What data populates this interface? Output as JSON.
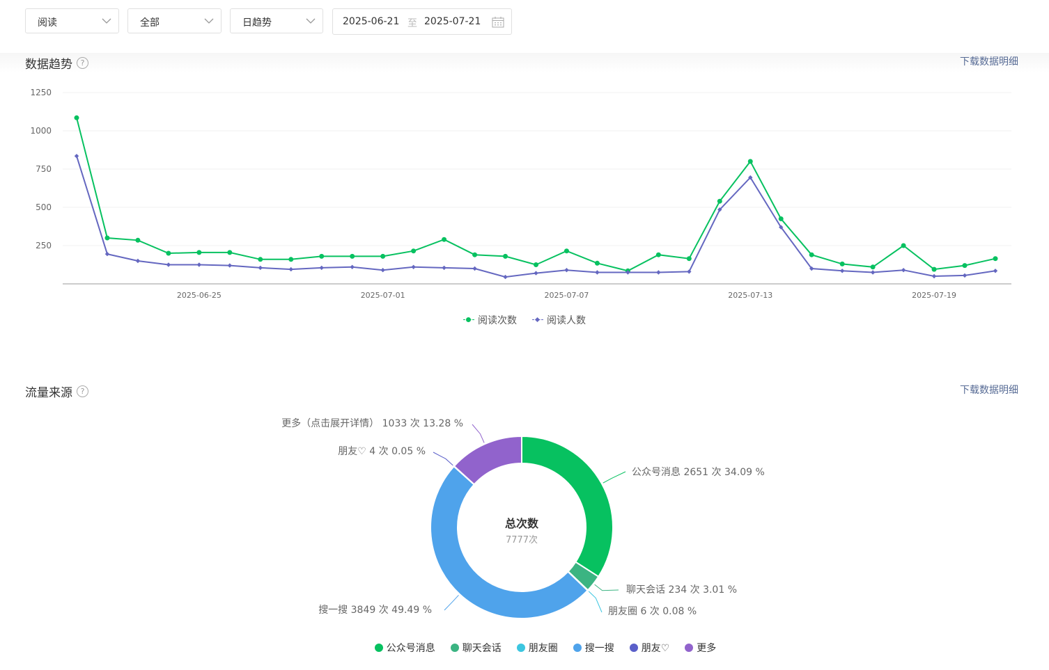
{
  "filters": {
    "metric": "阅读",
    "scope": "全部",
    "granularity": "日趋势",
    "date_start": "2025-06-21",
    "date_sep": "至",
    "date_end": "2025-07-21"
  },
  "trend_section": {
    "title": "数据趋势",
    "help": "?",
    "download": "下载数据明细"
  },
  "source_section": {
    "title": "流量来源",
    "help": "?",
    "download": "下载数据明细"
  },
  "colors": {
    "green": "#07c160",
    "indigo": "#6467c0",
    "link": "#576b95"
  },
  "chart_data": [
    {
      "type": "line",
      "x": [
        "2025-06-21",
        "2025-06-22",
        "2025-06-23",
        "2025-06-24",
        "2025-06-25",
        "2025-06-26",
        "2025-06-27",
        "2025-06-28",
        "2025-06-29",
        "2025-06-30",
        "2025-07-01",
        "2025-07-02",
        "2025-07-03",
        "2025-07-04",
        "2025-07-05",
        "2025-07-06",
        "2025-07-07",
        "2025-07-08",
        "2025-07-09",
        "2025-07-10",
        "2025-07-11",
        "2025-07-12",
        "2025-07-13",
        "2025-07-14",
        "2025-07-15",
        "2025-07-16",
        "2025-07-17",
        "2025-07-18",
        "2025-07-19",
        "2025-07-20",
        "2025-07-21"
      ],
      "xticks": [
        "2025-06-25",
        "2025-07-01",
        "2025-07-07",
        "2025-07-13",
        "2025-07-19"
      ],
      "yticks": [
        250,
        500,
        750,
        1000,
        1250
      ],
      "ylim": [
        0,
        1250
      ],
      "series": [
        {
          "name": "阅读次数",
          "color": "#07c160",
          "marker": "circle",
          "values": [
            1085,
            300,
            285,
            200,
            205,
            205,
            160,
            160,
            180,
            180,
            180,
            215,
            290,
            190,
            180,
            125,
            215,
            135,
            85,
            190,
            165,
            540,
            800,
            425,
            190,
            130,
            110,
            250,
            95,
            120,
            165
          ]
        },
        {
          "name": "阅读人数",
          "color": "#6467c0",
          "marker": "diamond",
          "values": [
            835,
            195,
            150,
            125,
            125,
            120,
            105,
            95,
            105,
            110,
            90,
            110,
            105,
            100,
            45,
            70,
            90,
            75,
            75,
            75,
            80,
            485,
            695,
            370,
            100,
            85,
            75,
            90,
            50,
            55,
            85
          ]
        }
      ]
    },
    {
      "type": "pie",
      "center_title": "总次数",
      "center_value": "7777次",
      "slices": [
        {
          "name": "公众号消息",
          "count": 2651,
          "unit": "次",
          "percent": "34.09 %",
          "color": "#07c160",
          "label": "公众号消息 2651 次 34.09 %"
        },
        {
          "name": "聊天会话",
          "count": 234,
          "unit": "次",
          "percent": "3.01 %",
          "color": "#3bb482",
          "label": "聊天会话 234 次 3.01 %"
        },
        {
          "name": "朋友圈",
          "count": 6,
          "unit": "次",
          "percent": "0.08 %",
          "color": "#3cc6e0",
          "label": "朋友圈 6 次 0.08 %"
        },
        {
          "name": "搜一搜",
          "count": 3849,
          "unit": "次",
          "percent": "49.49 %",
          "color": "#4fa3eb",
          "label": "搜一搜 3849 次 49.49 %"
        },
        {
          "name": "朋友♡",
          "count": 4,
          "unit": "次",
          "percent": "0.05 %",
          "color": "#5a5fc9",
          "label": "朋友♡ 4 次 0.05 %"
        },
        {
          "name": "更多",
          "count": 1033,
          "unit": "次",
          "percent": "13.28 %",
          "color": "#9163cc",
          "label": "更多（点击展开详情） 1033 次 13.28 %"
        }
      ]
    }
  ]
}
